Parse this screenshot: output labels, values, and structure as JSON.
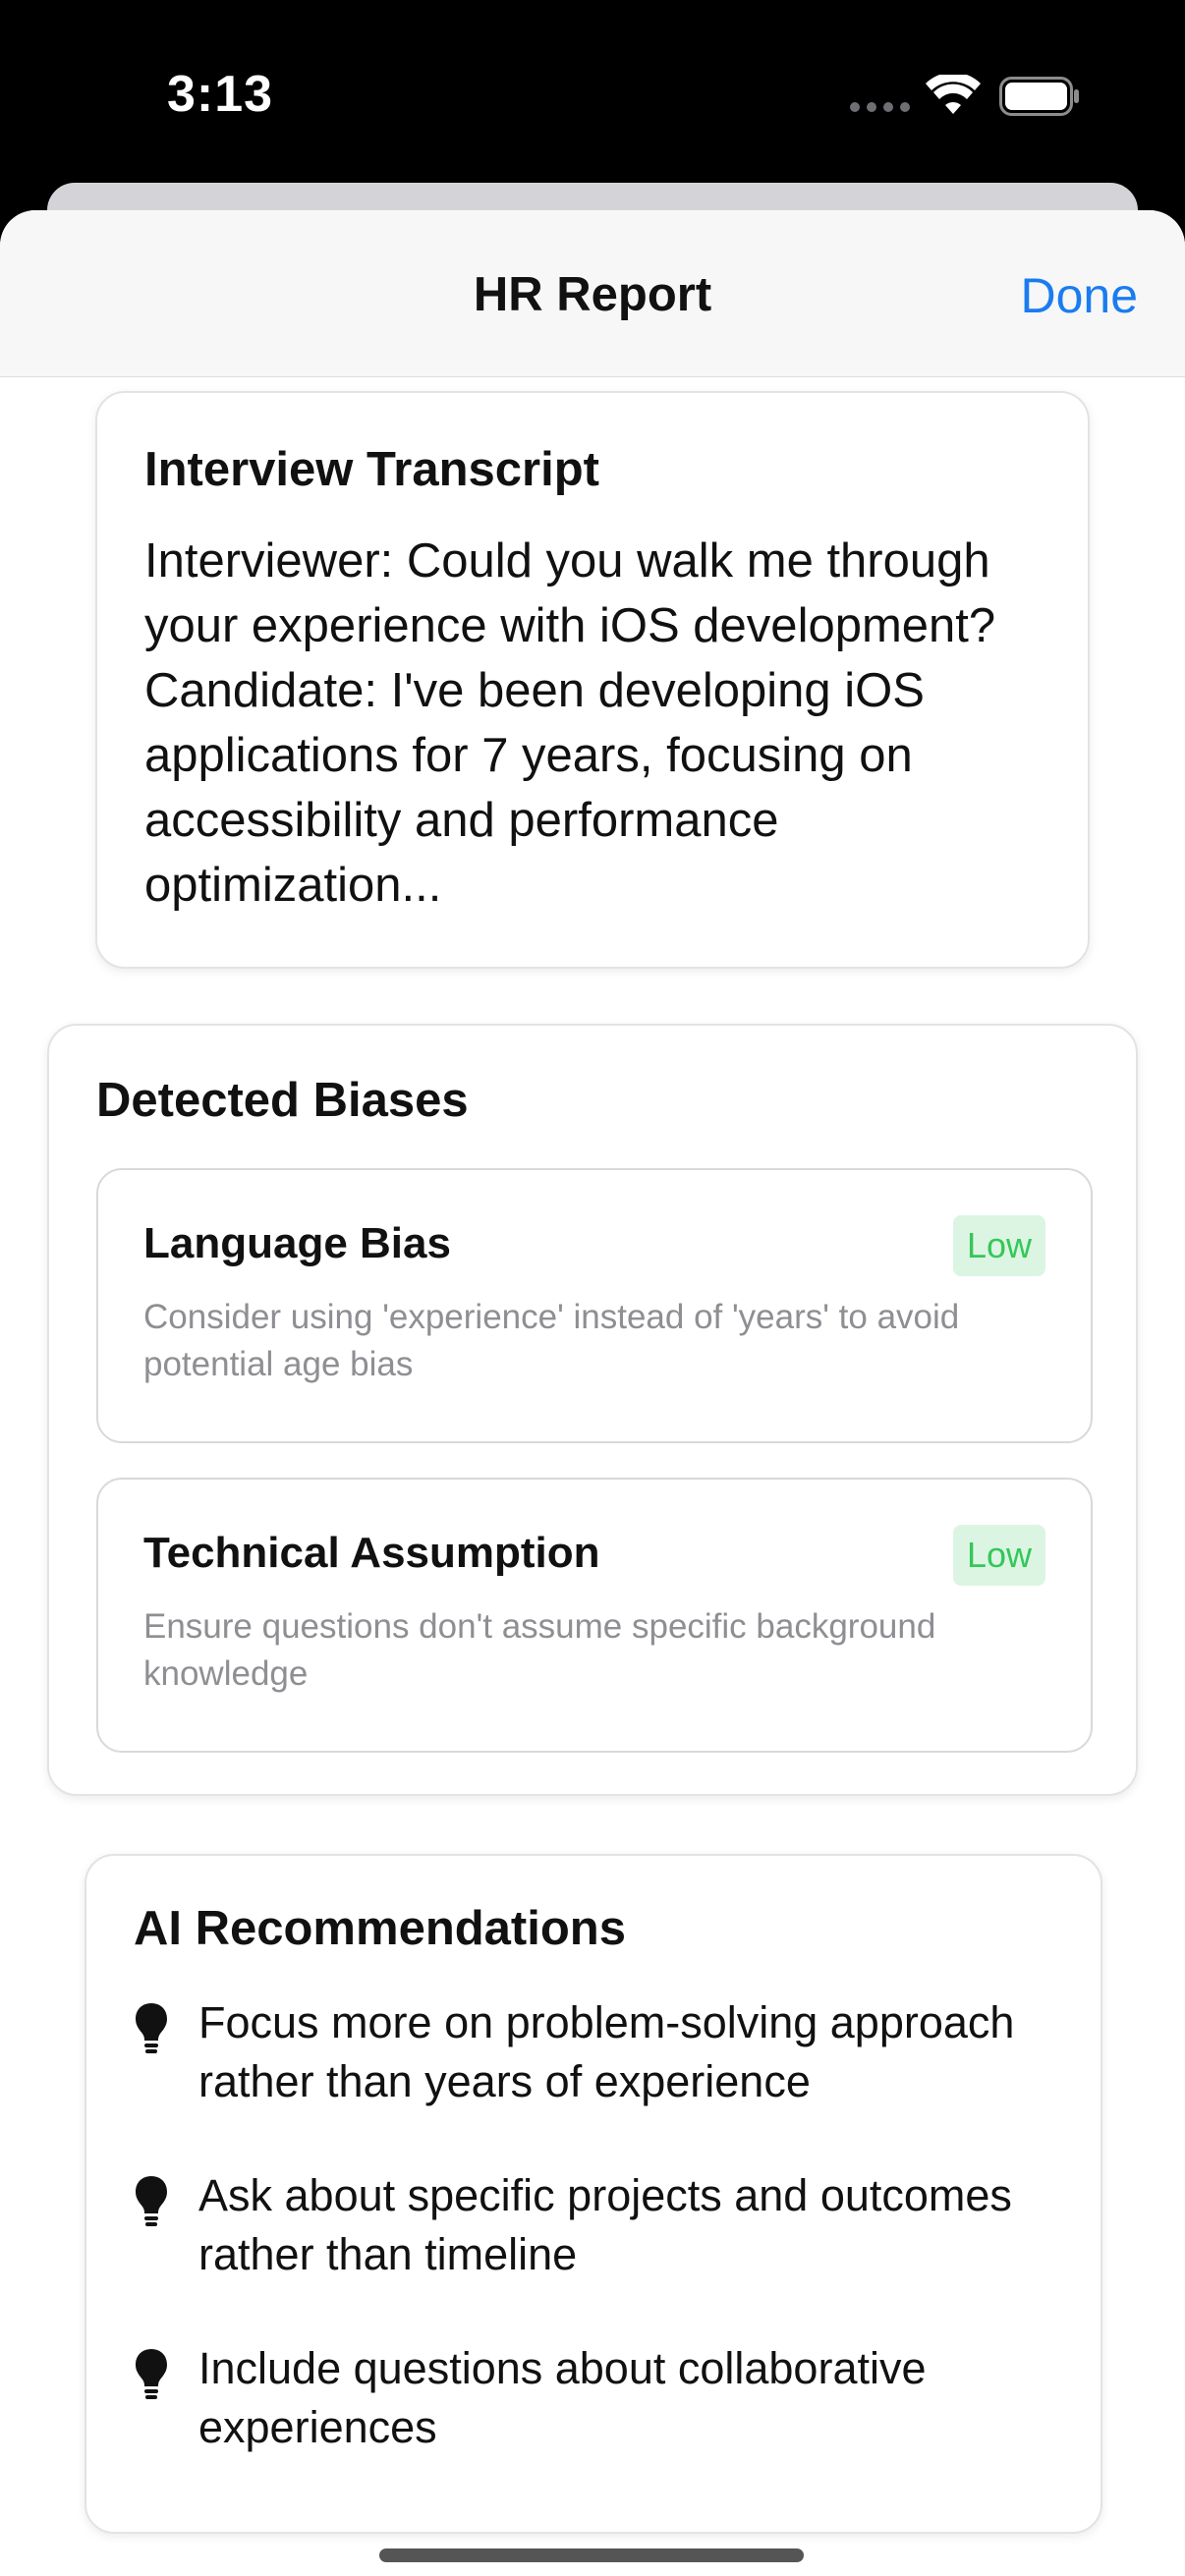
{
  "status_bar": {
    "time": "3:13"
  },
  "nav": {
    "title": "HR Report",
    "done_label": "Done"
  },
  "transcript": {
    "title": "Interview Transcript",
    "text": "Interviewer: Could you walk me through your experience with iOS development? Candidate: I've been developing iOS applications for 7 years, focusing on accessibility and performance optimization..."
  },
  "biases": {
    "title": "Detected Biases",
    "items": [
      {
        "title": "Language Bias",
        "severity": "Low",
        "description": "Consider using 'experience' instead of 'years' to avoid potential age bias"
      },
      {
        "title": "Technical Assumption",
        "severity": "Low",
        "description": "Ensure questions don't assume specific background knowledge"
      }
    ]
  },
  "recommendations": {
    "title": "AI Recommendations",
    "icon": "lightbulb-icon",
    "items": [
      "Focus more on problem-solving approach rather than years of experience",
      "Ask about specific projects and outcomes rather than timeline",
      "Include questions about collaborative experiences"
    ]
  },
  "colors": {
    "accent": "#1a7cf0",
    "severity_low_text": "#34c759",
    "severity_low_bg": "#dcf5e3"
  }
}
